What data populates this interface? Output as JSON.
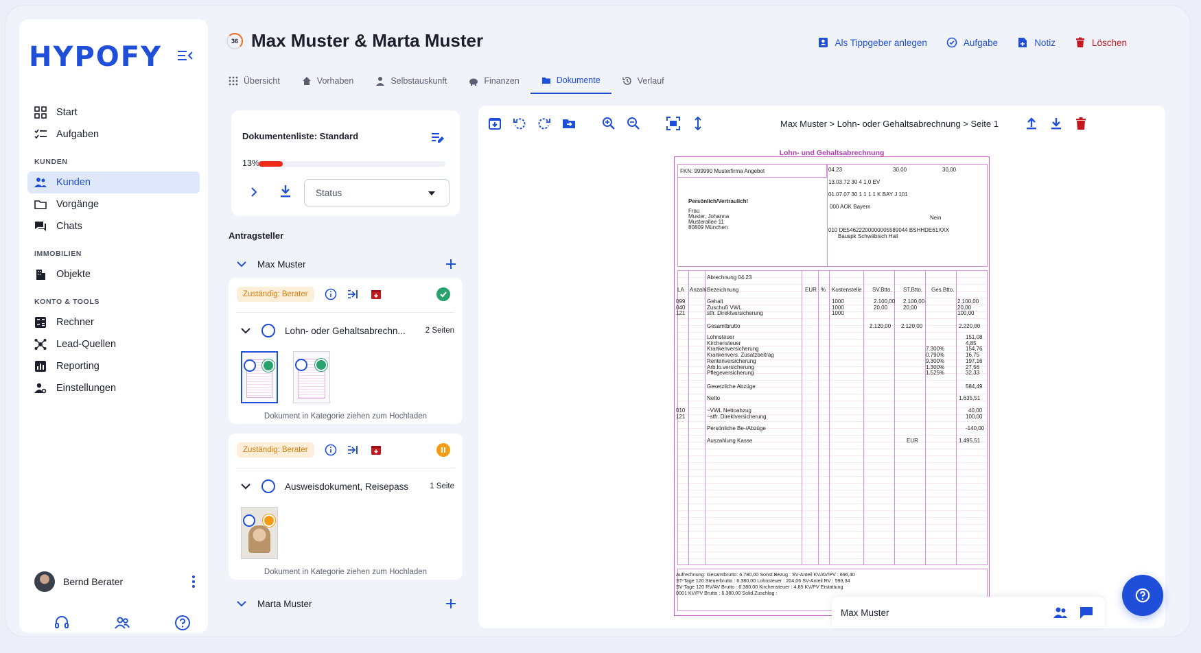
{
  "app": {
    "logo": "HYPOFY"
  },
  "sidebar": {
    "items": [
      {
        "label": "Start"
      },
      {
        "label": "Aufgaben"
      }
    ],
    "sections": {
      "kunden": "KUNDEN",
      "immobilien": "IMMOBILIEN",
      "konto": "KONTO & TOOLS"
    },
    "kunden_items": [
      {
        "label": "Kunden"
      },
      {
        "label": "Vorgänge"
      },
      {
        "label": "Chats"
      }
    ],
    "immobilien_items": [
      {
        "label": "Objekte"
      }
    ],
    "konto_items": [
      {
        "label": "Rechner"
      },
      {
        "label": "Lead-Quellen"
      },
      {
        "label": "Reporting"
      },
      {
        "label": "Einstellungen"
      }
    ],
    "user": {
      "name": "Bernd Berater"
    }
  },
  "header": {
    "score": "36",
    "title": "Max Muster & Marta Muster",
    "actions": {
      "tippgeber": "Als Tippgeber anlegen",
      "aufgabe": "Aufgabe",
      "notiz": "Notiz",
      "loeschen": "Löschen"
    }
  },
  "tabs": [
    {
      "label": "Übersicht"
    },
    {
      "label": "Vorhaben"
    },
    {
      "label": "Selbstauskunft"
    },
    {
      "label": "Finanzen"
    },
    {
      "label": "Dokumente"
    },
    {
      "label": "Verlauf"
    }
  ],
  "doclist": {
    "title": "Dokumentenliste: Standard",
    "progress_label": "13%",
    "progress": 0.13,
    "status_placeholder": "Status"
  },
  "antragsteller": {
    "label": "Antragsteller",
    "persons": [
      {
        "name": "Max Muster"
      },
      {
        "name": "Marta Muster"
      }
    ]
  },
  "documents": [
    {
      "badge": "Zuständig: Berater",
      "name": "Lohn- oder Gehaltsabrechn...",
      "pages": "2 Seiten",
      "dropzone": "Dokument in Kategorie ziehen zum Hochladen",
      "status": "complete"
    },
    {
      "badge": "Zuständig: Berater",
      "name": "Ausweisdokument, Reisepass",
      "pages": "1 Seite",
      "dropzone": "Dokument in Kategorie ziehen zum Hochladen",
      "status": "pending"
    }
  ],
  "viewer": {
    "breadcrumb": "Max Muster > Lohn- oder Gehaltsabrechnung > Seite 1",
    "doc": {
      "title": "Lohn- und Gehaltsabrechnung",
      "company": "FKN: 999990 Musterfirma Angebot",
      "confidential": "Persönlich/Vertraulich!",
      "addr1": "Frau",
      "addr2": "Muster, Johanna",
      "addr3": "Musterallee 11",
      "addr4": "80809 München",
      "period": "04.23",
      "val1": "30.00",
      "val2": "30,00",
      "date_row": "13.03.72  30  4    1,0     EV",
      "date_row2": "01.07.07  30  1   1  1  1  K  BAY     J      101",
      "insurer_code": "000    AOK Bayern",
      "nein": "Nein",
      "iban": "010  DE54622200000005589044       BSHHDE61XXX",
      "bank": "Bauspk Schwäbisch Hall",
      "abrechnung": "Abrechnung                    04.23",
      "col_la": "LA",
      "col_anzahl": "Anzahl",
      "col_bez": "Bezeichnung",
      "col_eur": "EUR",
      "col_pct": "%",
      "col_kst": "Kostenstelle",
      "col_sv": "SV.Btto.",
      "col_st": "ST.Btto.",
      "col_ges": "Ges.Btto.",
      "rows": [
        {
          "la": "099",
          "bez": "Gehalt",
          "kst": "1000",
          "sv": "2.100,00",
          "st": "2.100,00",
          "ges": "2.100,00"
        },
        {
          "la": "040",
          "bez": "Zuschuß VWL",
          "kst": "1000",
          "sv": "20,00",
          "st": "20,00",
          "ges": "20,00"
        },
        {
          "la": "121",
          "bez": "stfr. Direktversicherung",
          "kst": "1000",
          "sv": "",
          "st": "",
          "ges": "100,00"
        }
      ],
      "gesamtbrutto": "Gesamtbrutto",
      "gb_sv": "2.120,00",
      "gb_st": "2.120,00",
      "gb_ges": "2.220,00",
      "deductions": [
        {
          "bez": "Lohnsteuer",
          "pct": "",
          "val": "151,08"
        },
        {
          "bez": "Kirchensteuer",
          "pct": "",
          "val": "4,85"
        },
        {
          "bez": "Krankenversicherung",
          "pct": "7.300%",
          "val": "154,76"
        },
        {
          "bez": "Krankenvers. Zusatzbeitrag",
          "pct": "0.790%",
          "val": "16,75"
        },
        {
          "bez": "Rentenversicherung",
          "pct": "9.300%",
          "val": "197,16"
        },
        {
          "bez": "Arb.lo.versicherung",
          "pct": "1.300%",
          "val": "27,56"
        },
        {
          "bez": "Pflegeversicherung",
          "pct": "1.525%",
          "val": "32,33"
        }
      ],
      "gesetzl": "Gesetzliche Abzüge",
      "gesetzl_val": "584,49",
      "netto": "Netto",
      "netto_val": "1.635,51",
      "vwl_la": "010",
      "vwl": "~VWL Nettoabzug",
      "vwl_val": "40,00",
      "dv_la": "121",
      "dv": "~stfr. Direktversicherung",
      "dv_val": "100,00",
      "pers": "Persönliche Be-/Abzüge",
      "pers_val": "-140,00",
      "auszahlung": "Auszahlung Kasse",
      "auszahlung_cur": "EUR",
      "auszahlung_val": "1.495,51",
      "foot1": "Aufrechnung:       Gesamtbrutto:     6.780,00   Sonst.Bezug    :                       SV-Anteil KV/AV/PV :        696,40",
      "foot2": "ST-Tage 120      Steuerbrutto  :    6.380,00   Lohnsteuer     :      204,06   SV-Anteil RV        :        593,34",
      "foot3": "SV-Tage 120      RV/AV Brutto :    6.380,00   Kirchensteuer :          4,85   KV/PV Erstattung",
      "foot4": "0001                 KV/PV Brutto :    6.380,00   Solid.Zuschlag :"
    }
  },
  "chat": {
    "name": "Max Muster"
  },
  "colors": {
    "primary": "#1f4fd8",
    "danger": "#c4171e",
    "success": "#2aa26d",
    "warning": "#f39c12",
    "badge_text": "#d97b08"
  }
}
